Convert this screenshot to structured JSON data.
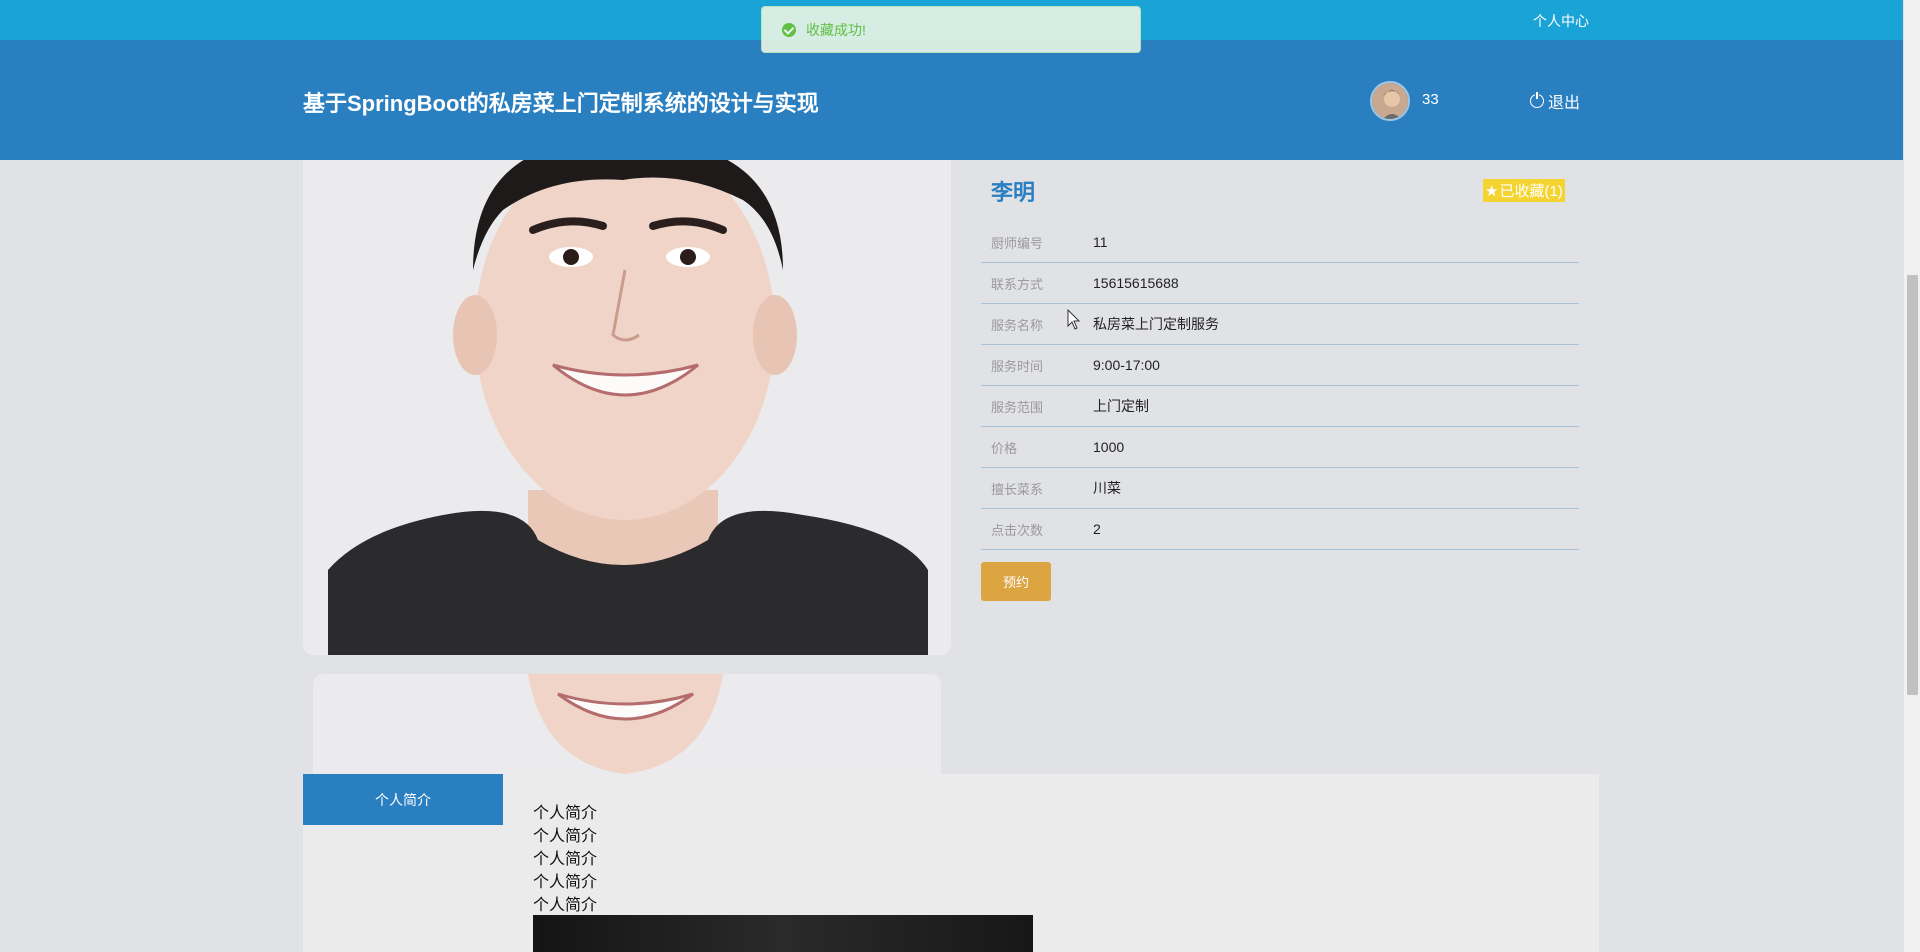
{
  "topbar": {
    "user_center": "个人中心"
  },
  "toast": {
    "message": "收藏成功!"
  },
  "header": {
    "site_title": "基于SpringBoot的私房菜上门定制系统的设计与实现",
    "username": "33",
    "logout_label": "退出"
  },
  "chef": {
    "name": "李明",
    "favorite_label": "已收藏(1)",
    "fields": [
      {
        "label": "厨师编号",
        "value": "11"
      },
      {
        "label": "联系方式",
        "value": "15615615688"
      },
      {
        "label": "服务名称",
        "value": "私房菜上门定制服务"
      },
      {
        "label": "服务时间",
        "value": "9:00-17:00"
      },
      {
        "label": "服务范围",
        "value": "上门定制"
      },
      {
        "label": "价格",
        "value": "1000"
      },
      {
        "label": "擅长菜系",
        "value": "川菜"
      },
      {
        "label": "点击次数",
        "value": "2"
      }
    ],
    "book_label": "预约"
  },
  "tabs": {
    "intro_label": "个人简介"
  },
  "intro": {
    "lines": [
      "个人简介",
      "个人简介",
      "个人简介",
      "个人简介",
      "个人简介"
    ]
  },
  "colors": {
    "header_bg": "#2a7fc1",
    "top_strip_bg": "#1aa3d6",
    "favorite_bg": "#f4d431",
    "book_button_bg": "#dca542",
    "toast_text": "#67c23a"
  }
}
